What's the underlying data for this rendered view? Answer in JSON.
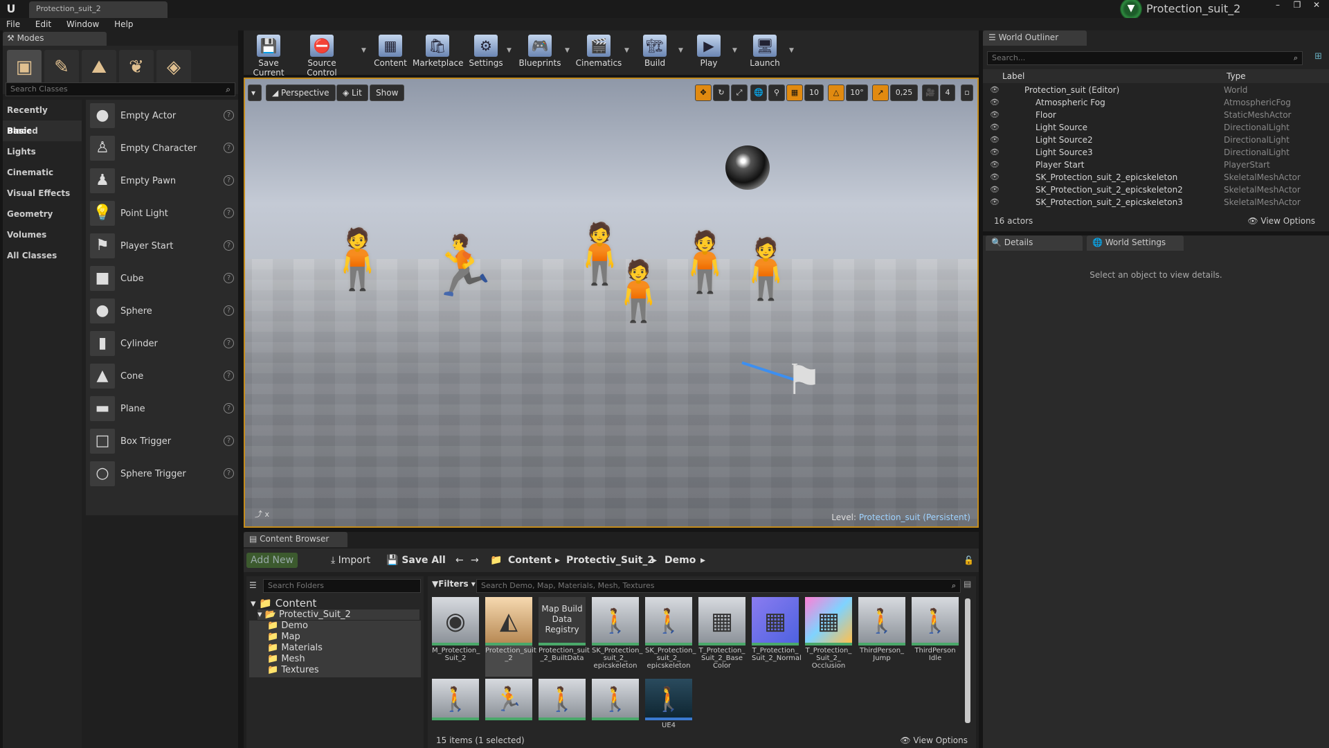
{
  "window": {
    "tab_title": "Protection_suit_2",
    "project_name": "Protection_suit_2"
  },
  "menu": [
    "File",
    "Edit",
    "Window",
    "Help"
  ],
  "modes": {
    "tab_label": "Modes",
    "search_placeholder": "Search Classes",
    "categories": [
      "Recently Placed",
      "Basic",
      "Lights",
      "Cinematic",
      "Visual Effects",
      "Geometry",
      "Volumes",
      "All Classes"
    ],
    "active_category": "Basic",
    "actors": [
      "Empty Actor",
      "Empty Character",
      "Empty Pawn",
      "Point Light",
      "Player Start",
      "Cube",
      "Sphere",
      "Cylinder",
      "Cone",
      "Plane",
      "Box Trigger",
      "Sphere Trigger"
    ]
  },
  "toolbar": {
    "buttons": [
      "Save Current",
      "Source Control",
      "Content",
      "Marketplace",
      "Settings",
      "Blueprints",
      "Cinematics",
      "Build",
      "Play",
      "Launch"
    ]
  },
  "viewport": {
    "view_mode": "Perspective",
    "lighting": "Lit",
    "show": "Show",
    "grid_snap": "10",
    "rotation_snap": "10°",
    "scale_snap": "0,25",
    "camera_speed": "4",
    "level_prefix": "Level:",
    "level_name": "Protection_suit (Persistent)"
  },
  "outliner": {
    "tab_label": "World Outliner",
    "search_placeholder": "Search...",
    "col_label": "Label",
    "col_type": "Type",
    "rows": [
      {
        "label": "Protection_suit (Editor)",
        "type": "World",
        "indent": 0
      },
      {
        "label": "Atmospheric Fog",
        "type": "AtmosphericFog",
        "indent": 1
      },
      {
        "label": "Floor",
        "type": "StaticMeshActor",
        "indent": 1
      },
      {
        "label": "Light Source",
        "type": "DirectionalLight",
        "indent": 1
      },
      {
        "label": "Light Source2",
        "type": "DirectionalLight",
        "indent": 1
      },
      {
        "label": "Light Source3",
        "type": "DirectionalLight",
        "indent": 1
      },
      {
        "label": "Player Start",
        "type": "PlayerStart",
        "indent": 1
      },
      {
        "label": "SK_Protection_suit_2_epicskeleton",
        "type": "SkeletalMeshActor",
        "indent": 1
      },
      {
        "label": "SK_Protection_suit_2_epicskeleton2",
        "type": "SkeletalMeshActor",
        "indent": 1
      },
      {
        "label": "SK_Protection_suit_2_epicskeleton3",
        "type": "SkeletalMeshActor",
        "indent": 1
      }
    ],
    "actor_count": "16 actors",
    "view_options": "View Options"
  },
  "details": {
    "tab_details": "Details",
    "tab_world_settings": "World Settings",
    "empty_message": "Select an object to view details."
  },
  "content_browser": {
    "tab_label": "Content Browser",
    "add_new": "Add New",
    "import": "Import",
    "save_all": "Save All",
    "breadcrumb": [
      "Content",
      "Protectiv_Suit_2",
      "Demo"
    ],
    "folder_search_placeholder": "Search Folders",
    "folders": {
      "root": "Content",
      "project": "Protectiv_Suit_2",
      "children": [
        "Demo",
        "Map",
        "Materials",
        "Mesh",
        "Textures"
      ]
    },
    "filters": "Filters",
    "asset_search_placeholder": "Search Demo, Map, Materials, Mesh, Textures",
    "assets": [
      {
        "name": "M_Protection_ Suit_2",
        "icon": "◉"
      },
      {
        "name": "Protection_suit _2",
        "icon": "◭"
      },
      {
        "name": "Protection_suit _2_BuiltData",
        "icon": "Map Build Data Registry"
      },
      {
        "name": "SK_Protection_ suit_2_ epicskeleton",
        "icon": "🚶"
      },
      {
        "name": "SK_Protection_ suit_2_ epicskeleton",
        "icon": "🚶"
      },
      {
        "name": "T_Protection_ Suit_2_Base Color",
        "icon": "▦"
      },
      {
        "name": "T_Protection_ Suit_2_Normal",
        "icon": "▦"
      },
      {
        "name": "T_Protection_ Suit_2_ Occlusion",
        "icon": "▦"
      },
      {
        "name": "ThirdPerson_ Jump",
        "icon": "🚶"
      },
      {
        "name": "ThirdPerson Idle",
        "icon": "🚶"
      }
    ],
    "row2_icons": [
      "🚶",
      "🏃",
      "🚶",
      "🚶",
      "🚶"
    ],
    "row2_partial_label": "UE4",
    "items_count": "15 items (1 selected)",
    "view_options": "View Options"
  }
}
